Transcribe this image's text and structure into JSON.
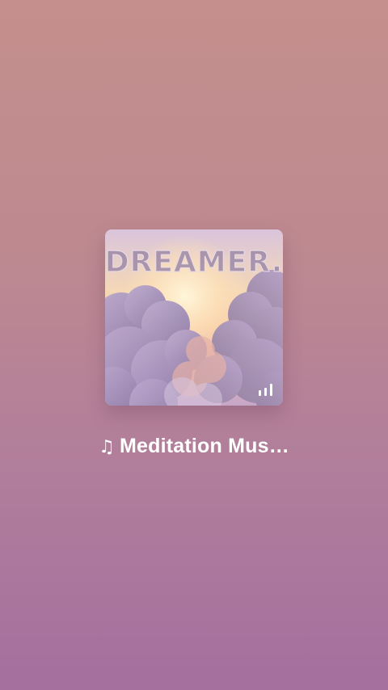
{
  "media": {
    "artwork": {
      "image_text": "DREAMER.",
      "description_icon": "cloud-sky-artwork"
    },
    "playing_indicator_icon": "equalizer-bars-icon",
    "title_icon": "music-note-icon",
    "title_icon_glyph": "♫",
    "title": "Meditation Mus…"
  },
  "colors": {
    "background_top": "#c48f8c",
    "background_bottom": "#a56f9e",
    "text": "#ffffff"
  }
}
